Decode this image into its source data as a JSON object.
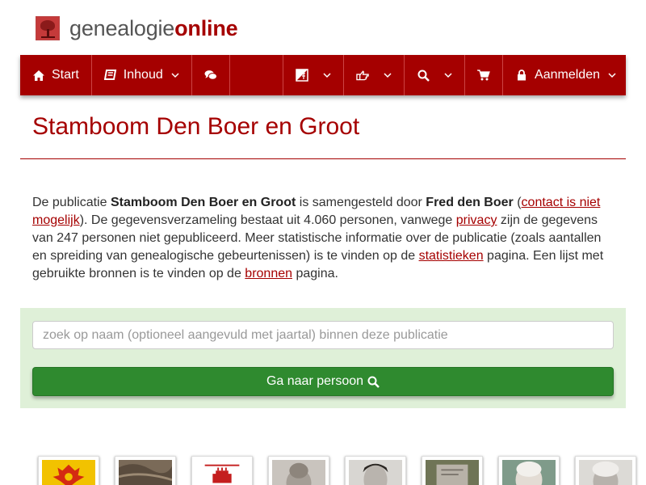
{
  "brand": {
    "part1": "genealogie",
    "part2": "online"
  },
  "nav": {
    "start": "Start",
    "inhoud": "Inhoud",
    "aanmelden": "Aanmelden"
  },
  "page": {
    "title": "Stamboom Den Boer en Groot"
  },
  "intro": {
    "t1": "De publicatie ",
    "pub": "Stamboom Den Boer en Groot",
    "t2": " is samengesteld door ",
    "author": "Fred den Boer",
    "t3": " (",
    "contact_link": "contact is niet mogelijk",
    "t4": "). De gegevensverzameling bestaat uit 4.060 personen, vanwege ",
    "privacy_link": "privacy",
    "t5": " zijn de gegevens van 247 personen niet gepubliceerd. Meer statistische informatie over de publicatie (zoals aantallen en spreiding van genealogische gebeurtenissen) is te vinden op de ",
    "stats_link": "statistieken",
    "t6": " pagina. Een lijst met gebruikte bronnen is te vinden op de ",
    "sources_link": "bronnen",
    "t7": " pagina."
  },
  "search": {
    "placeholder": "zoek op naam (optioneel aangevuld met jaartal) binnen deze publicatie",
    "button_label": "Ga naar persoon"
  },
  "colors": {
    "brand_red": "#a50000",
    "panel_green": "#dff0d8",
    "button_green": "#2f8a2f"
  }
}
